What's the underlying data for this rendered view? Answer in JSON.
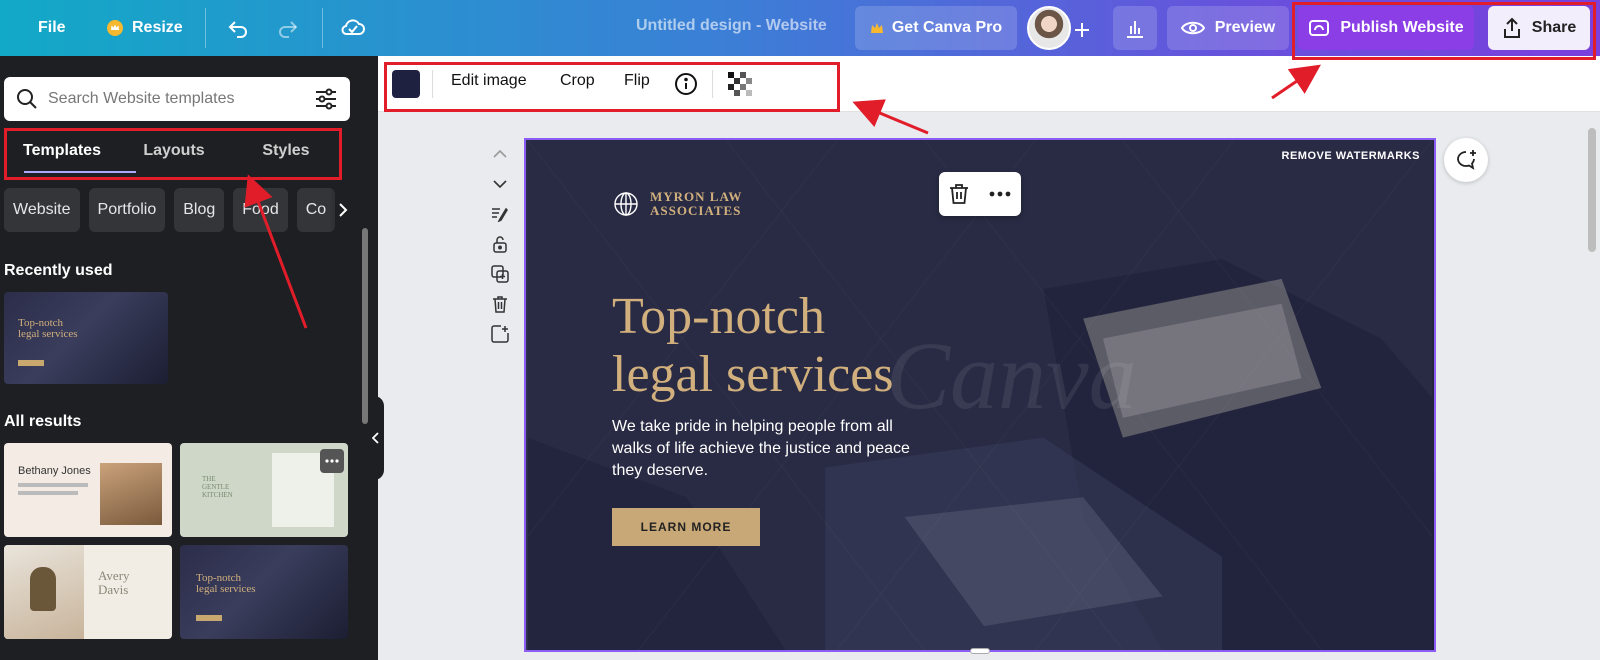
{
  "topbar": {
    "file_label": "File",
    "resize_label": "Resize",
    "doc_title": "Untitled design - Website",
    "pro_label": "Get Canva Pro",
    "preview_label": "Preview",
    "publish_label": "Publish Website",
    "share_label": "Share"
  },
  "left_panel": {
    "search_placeholder": "Search Website templates",
    "tabs": [
      {
        "label": "Templates",
        "active": true
      },
      {
        "label": "Layouts",
        "active": false
      },
      {
        "label": "Styles",
        "active": false
      }
    ],
    "chips": [
      "Website",
      "Portfolio",
      "Blog",
      "Food",
      "Co"
    ],
    "recently_used_heading": "Recently used",
    "all_results_heading": "All results",
    "recent_thumb": {
      "title_line1": "Top-notch",
      "title_line2": "legal services"
    },
    "result_thumbs": [
      {
        "title": "Bethany Jones"
      },
      {
        "title_line1": "THE",
        "title_line2": "GENTLE",
        "title_line3": "KITCHEN"
      },
      {
        "title_line1": "Avery",
        "title_line2": "Davis"
      },
      {
        "title_line1": "Top-notch",
        "title_line2": "legal services"
      }
    ]
  },
  "toolbar": {
    "edit_image_label": "Edit image",
    "crop_label": "Crop",
    "flip_label": "Flip",
    "swatch_color": "#1f2140"
  },
  "canvas": {
    "remove_watermarks": "REMOVE WATERMARKS",
    "logo_line1": "MYRON LAW",
    "logo_line2": "ASSOCIATES",
    "hero_line1": "Top-notch",
    "hero_line2": "legal services",
    "hero_sub": "We take pride in helping people from all walks of life achieve the justice and peace they deserve.",
    "cta_label": "LEARN MORE",
    "watermark_text": "Canva"
  },
  "colors": {
    "accent_gold": "#d1b07e",
    "annotation_red": "#e11d2a",
    "publish_purple": "#8b3ee6",
    "selection_purple": "#8b5cf6"
  }
}
